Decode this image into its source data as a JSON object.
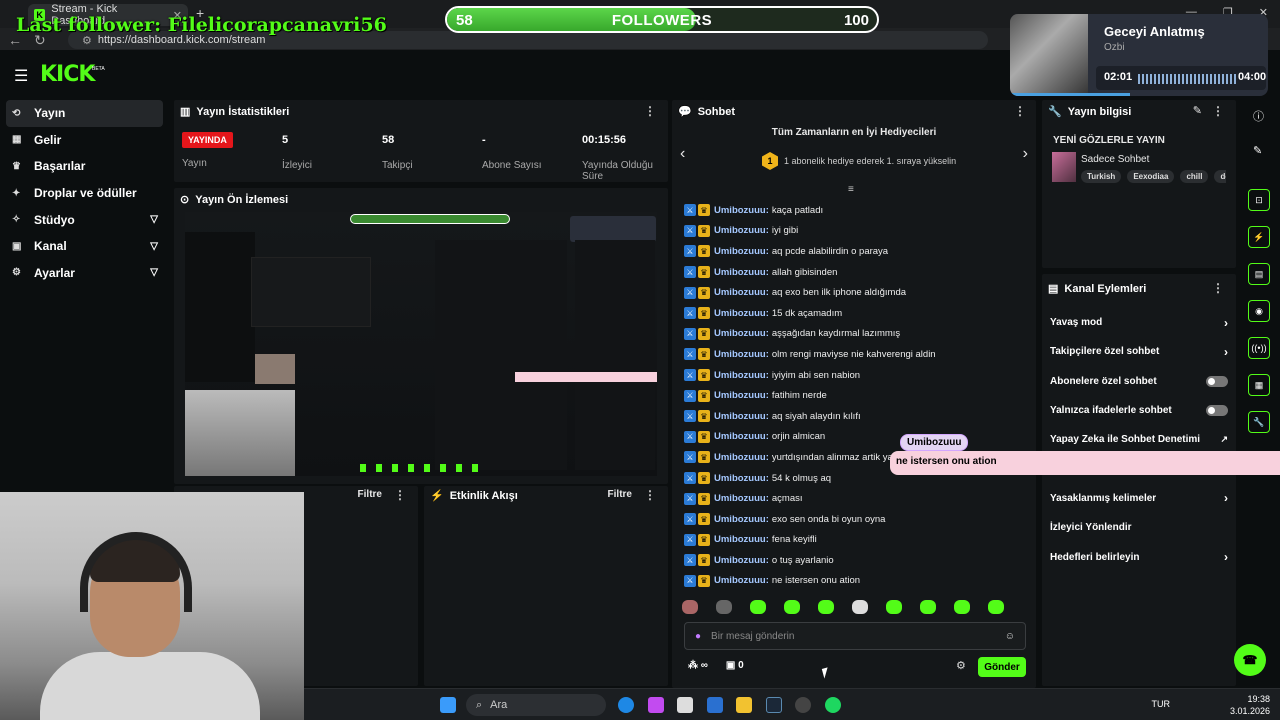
{
  "browser": {
    "tab_title": "Stream - Kick Dashboard",
    "url": "https://dashboard.kick.com/stream",
    "new_tab": "+"
  },
  "overlay": {
    "last_follower": "Last follower: Filelicorapcanavri56",
    "followers_current": "58",
    "followers_label": "FOLLOWERS",
    "followers_goal": "100",
    "followers_progress": 0.58
  },
  "music": {
    "title": "Geceyi Anlatmış",
    "artist": "Ozbi",
    "elapsed": "02:01",
    "duration": "04:00"
  },
  "brand": {
    "logo": "KICK",
    "beta": "BETA"
  },
  "sidebar": {
    "items": [
      {
        "label": "Yayın",
        "icon": "stream-icon",
        "expand": false
      },
      {
        "label": "Gelir",
        "icon": "revenue-icon",
        "expand": false
      },
      {
        "label": "Başarılar",
        "icon": "trophy-icon",
        "expand": false
      },
      {
        "label": "Droplar ve ödüller",
        "icon": "gift-icon",
        "expand": false
      },
      {
        "label": "Stüdyo",
        "icon": "studio-icon",
        "expand": true
      },
      {
        "label": "Kanal",
        "icon": "channel-icon",
        "expand": true
      },
      {
        "label": "Ayarlar",
        "icon": "gear-icon",
        "expand": true
      }
    ]
  },
  "stats": {
    "title": "Yayın İstatistikleri",
    "live_badge": "YAYINDA",
    "live_label": "Yayın",
    "viewers_value": "5",
    "viewers_label": "İzleyici",
    "followers_value": "58",
    "followers_label": "Takipçi",
    "subs_value": "-",
    "subs_label": "Abone Sayısı",
    "uptime_value": "00:15:56",
    "uptime_label": "Yayında Olduğu Süre"
  },
  "preview": {
    "title": "Yayın Ön İzlemesi"
  },
  "bottom_panels": {
    "report_filter": "Filtre",
    "activity_title": "Etkinlik Akışı",
    "activity_filter": "Filtre"
  },
  "chat": {
    "title": "Sohbet",
    "gifters_title": "Tüm Zamanların en İyi Hediyecileri",
    "gifters_rank": "1",
    "gifters_text": "1 abonelik hediye ederek 1. sıraya yükselin",
    "username": "Umibozuuu:",
    "messages": [
      "kaça patladı",
      "iyi gibi",
      "aq pcde alabilirdin o paraya",
      "allah gibisinden",
      "aq exo ben ilk iphone aldığımda",
      "15 dk açamadım",
      "aşşağıdan kaydırmal lazımmış",
      "olm rengi maviyse nie kahverengi aldin",
      "iyiyim abi sen nabion",
      "fatihim nerde",
      "aq siyah alaydın kılıfı",
      "orjin almican",
      "yurtdışından alinmaz artik ya",
      "54 k olmuş aq",
      "açması",
      "exo sen onda bi oyun oyna",
      "fena keyifli",
      "o tuş ayarlanio",
      "ne istersen onu ation"
    ],
    "input_placeholder": "Bir mesaj gönderin",
    "points": "0",
    "send_label": "Gönder"
  },
  "stream_info": {
    "title": "Yayın bilgisi",
    "subtitle": "YENİ GÖZLERLE YAYIN",
    "category": "Sadece Sohbet",
    "tags": [
      "Turkish",
      "Eexodiaa",
      "chill",
      "de"
    ]
  },
  "channel_actions": {
    "title": "Kanal Eylemleri",
    "items": [
      {
        "label": "Yavaş mod",
        "kind": "chevron"
      },
      {
        "label": "Takipçilere özel sohbet",
        "kind": "chevron"
      },
      {
        "label": "Abonelere özel sohbet",
        "kind": "toggle"
      },
      {
        "label": "Yalnızca ifadelerle sohbet",
        "kind": "toggle"
      },
      {
        "label": "Yapay Zeka ile Sohbet Denetimi",
        "kind": "external"
      },
      {
        "label": "",
        "kind": "hidden"
      },
      {
        "label": "Yasaklanmış kelimeler",
        "kind": "chevron"
      },
      {
        "label": "İzleyici Yönlendir",
        "kind": "none"
      },
      {
        "label": "Hedefleri belirleyin",
        "kind": "chevron"
      }
    ]
  },
  "popup": {
    "name": "Umibozuuu",
    "text": "ne istersen onu ation"
  },
  "taskbar": {
    "search": "Ara",
    "lang": "TUR",
    "time": "19:38",
    "date": "3.01.2026"
  },
  "colors": {
    "accent": "#53fc18",
    "live": "#e5161b",
    "popup": "#f8d1dd"
  }
}
